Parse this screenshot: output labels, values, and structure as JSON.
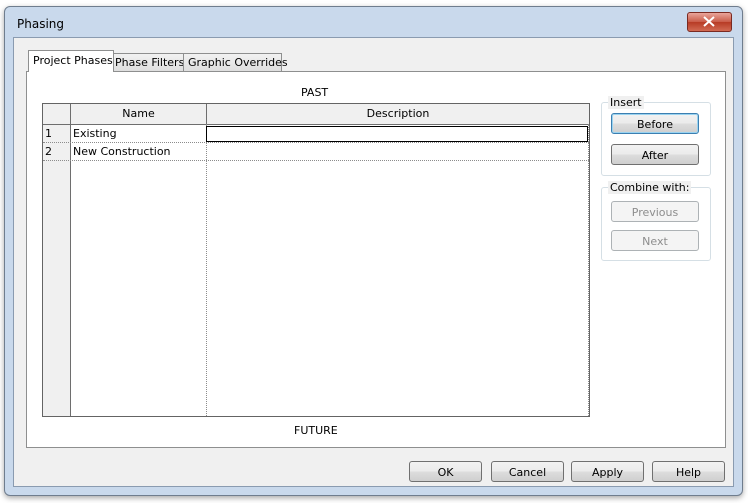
{
  "window": {
    "title": "Phasing"
  },
  "tabs": [
    {
      "label": "Project Phases"
    },
    {
      "label": "Phase Filters"
    },
    {
      "label": "Graphic Overrides"
    }
  ],
  "panel": {
    "past_label": "PAST",
    "future_label": "FUTURE"
  },
  "grid": {
    "columns": [
      "Name",
      "Description"
    ],
    "rows": [
      {
        "num": "1",
        "name": "Existing",
        "description": ""
      },
      {
        "num": "2",
        "name": "New Construction",
        "description": ""
      }
    ]
  },
  "insert_group": {
    "title": "Insert",
    "before_label": "Before",
    "after_label": "After"
  },
  "combine_group": {
    "title": "Combine with:",
    "previous_label": "Previous",
    "next_label": "Next"
  },
  "footer": {
    "ok_label": "OK",
    "cancel_label": "Cancel",
    "apply_label": "Apply",
    "help_label": "Help"
  },
  "colors": {
    "frame": "#c9d9ec",
    "client": "#f0f0f0",
    "close_red": "#c95b48"
  }
}
